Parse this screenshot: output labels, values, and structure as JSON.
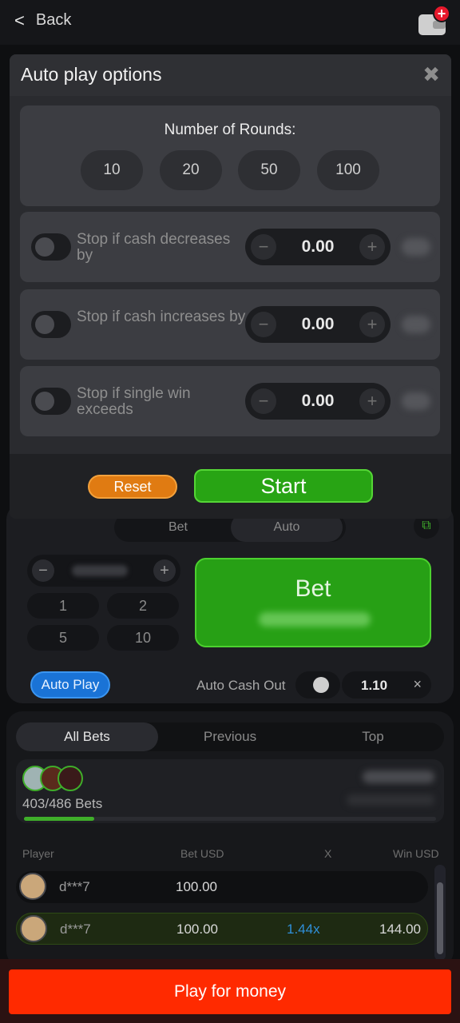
{
  "topbar": {
    "back_label": "Back",
    "back_icon": "<",
    "wallet_plus": "+"
  },
  "modal": {
    "title": "Auto play options",
    "close_icon": "✖",
    "rounds_title": "Number of Rounds:",
    "rounds": [
      "10",
      "20",
      "50",
      "100"
    ],
    "options": [
      {
        "label": "Stop if cash decreases by",
        "value": "0.00",
        "enabled": false
      },
      {
        "label": "Stop if cash increases by",
        "value": "0.00",
        "enabled": false
      },
      {
        "label": "Stop if single win exceeds",
        "value": "0.00",
        "enabled": false
      }
    ],
    "minus": "−",
    "plus": "+",
    "reset_label": "Reset",
    "start_label": "Start"
  },
  "game": {
    "tabs": [
      "Bet",
      "Auto"
    ],
    "quick_amounts": [
      "1",
      "2",
      "5",
      "10"
    ],
    "bet_button": "Bet",
    "auto_play_label": "Auto Play",
    "auto_cash_out_label": "Auto Cash Out",
    "auto_cash_out_value": "1.10",
    "auto_cash_out_clear": "×"
  },
  "bets": {
    "tabs": [
      "All Bets",
      "Previous",
      "Top"
    ],
    "count": "403/486 Bets",
    "progress": 0.17,
    "columns": [
      "Player",
      "Bet USD",
      "X",
      "Win USD"
    ],
    "rows": [
      {
        "player": "d***7",
        "bet": "100.00",
        "x": "",
        "win": ""
      },
      {
        "player": "d***7",
        "bet": "100.00",
        "x": "1.44x",
        "win": "144.00"
      }
    ]
  },
  "cta": {
    "label": "Play for money"
  },
  "colors": {
    "start": "#28a414",
    "reset": "#e07b12",
    "cta": "#ff2a00",
    "auto_play": "#1a73d6"
  }
}
